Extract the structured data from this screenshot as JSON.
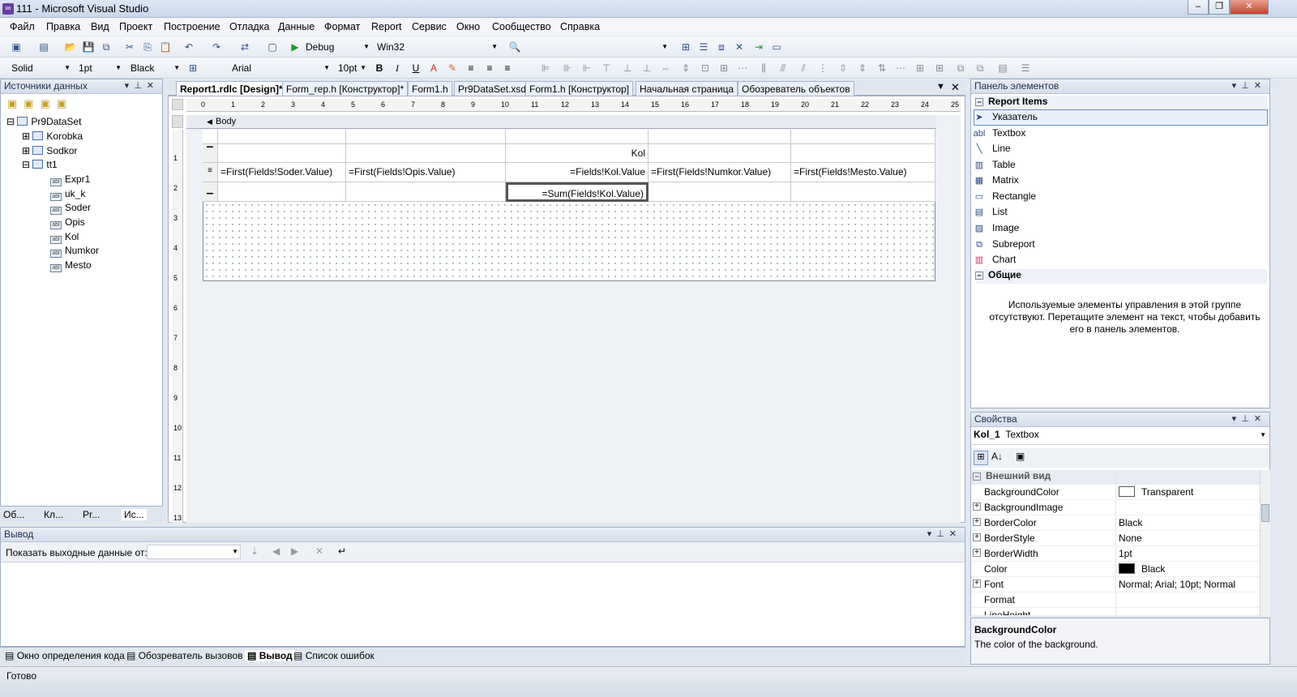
{
  "window": {
    "title": "111 - Microsoft Visual Studio"
  },
  "menu": [
    "Файл",
    "Правка",
    "Вид",
    "Проект",
    "Построение",
    "Отладка",
    "Данные",
    "Формат",
    "Report",
    "Сервис",
    "Окно",
    "Сообщество",
    "Справка"
  ],
  "toolbar": {
    "config": "Debug",
    "platform": "Win32"
  },
  "format_toolbar": {
    "line_style": "Solid",
    "line_width": "1pt",
    "color": "Black",
    "font": "Arial",
    "font_size": "10pt"
  },
  "data_sources": {
    "title": "Источники данных",
    "dataset": "Pr9DataSet",
    "tables": [
      "Korobka",
      "Sodkor",
      "tt1"
    ],
    "fields": [
      "Expr1",
      "uk_k",
      "Soder",
      "Opis",
      "Kol",
      "Numkor",
      "Mesto"
    ],
    "bottom_tabs": [
      "Об...",
      "Кл...",
      "Pr...",
      "Ис..."
    ]
  },
  "doc_tabs": [
    "Report1.rdlc [Design]*",
    "Form_rep.h [Конструктор]*",
    "Form1.h",
    "Pr9DataSet.xsd",
    "Form1.h [Конструктор]",
    "Начальная страница",
    "Обозреватель объектов"
  ],
  "ruler": [
    "0",
    "1",
    "2",
    "3",
    "4",
    "5",
    "6",
    "7",
    "8",
    "9",
    "10",
    "11",
    "12",
    "13",
    "14",
    "15",
    "16",
    "17",
    "18",
    "19",
    "20",
    "21",
    "22",
    "23",
    "24",
    "25"
  ],
  "ruler_v": [
    "1",
    "2",
    "3",
    "4",
    "5",
    "6",
    "7",
    "8",
    "9",
    "10",
    "11",
    "12",
    "13"
  ],
  "design": {
    "body_label": "Body",
    "header_row": [
      "",
      "",
      "Kol",
      "",
      ""
    ],
    "detail_row": [
      "=First(Fields!Soder.Value)",
      "=First(Fields!Opis.Value)",
      "=Fields!Kol.Value",
      "=First(Fields!Numkor.Value)",
      "=First(Fields!Mesto.Value)"
    ],
    "footer_row": [
      "",
      "",
      "=Sum(Fields!Kol.Value)",
      "",
      ""
    ]
  },
  "toolbox": {
    "title": "Панель элементов",
    "group1": "Report Items",
    "items": [
      "Указатель",
      "Textbox",
      "Line",
      "Table",
      "Matrix",
      "Rectangle",
      "List",
      "Image",
      "Subreport",
      "Chart"
    ],
    "group2": "Общие",
    "empty_text": "Используемые элементы управления в этой группе отсутствуют. Перетащите элемент на текст, чтобы добавить его в панель элементов."
  },
  "properties": {
    "title": "Свойства",
    "object": "Kol_1",
    "object_type": "Textbox",
    "category": "Внешний вид",
    "rows": [
      {
        "name": "BackgroundColor",
        "value": "Transparent"
      },
      {
        "name": "BackgroundImage",
        "value": ""
      },
      {
        "name": "BorderColor",
        "value": "Black"
      },
      {
        "name": "BorderStyle",
        "value": "None"
      },
      {
        "name": "BorderWidth",
        "value": "1pt"
      },
      {
        "name": "Color",
        "value": "Black"
      },
      {
        "name": "Font",
        "value": "Normal; Arial; 10pt; Normal"
      },
      {
        "name": "Format",
        "value": ""
      },
      {
        "name": "LineHeight",
        "value": ""
      }
    ],
    "desc_title": "BackgroundColor",
    "desc_text": "The color of the background."
  },
  "output": {
    "title": "Вывод",
    "show_label": "Показать выходные данные от:",
    "show_value": ""
  },
  "bottom_tabs": [
    "Окно определения кода",
    "Обозреватель вызовов",
    "Вывод",
    "Список ошибок"
  ],
  "status": "Готово",
  "colors": {
    "accent": "#6a3ea1",
    "panel_header": "#d5ddeb",
    "selection": "#e8f0fb"
  }
}
